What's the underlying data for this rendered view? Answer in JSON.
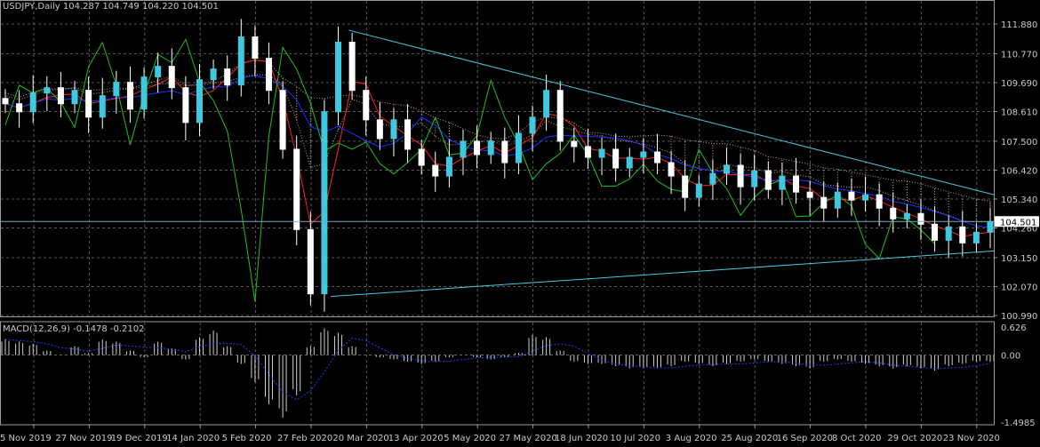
{
  "chart_data": {
    "type": "candlestick",
    "symbol_info": "USDJPY,Daily  104.287 104.749 104.220 104.501",
    "current_price": "104.501",
    "x": [
      "5 Nov 2019",
      "27 Nov 2019",
      "19 Dec 2019",
      "14 Jan 2020",
      "5 Feb 2020",
      "27 Feb 2020",
      "20 Mar 2020",
      "13 Apr 2020",
      "5 May 2020",
      "27 May 2020",
      "18 Jun 2020",
      "10 Jul 2020",
      "3 Aug 2020",
      "25 Aug 2020",
      "16 Sep 2020",
      "8 Oct 2020",
      "29 Oct 2020",
      "23 Nov 2020"
    ],
    "y_ticks": [
      "111.880",
      "110.770",
      "109.690",
      "108.610",
      "107.500",
      "106.420",
      "105.340",
      "104.260",
      "103.150",
      "102.070",
      "100.990"
    ],
    "ylim": [
      100.99,
      111.88
    ],
    "close_approx": [
      108.9,
      108.6,
      109.3,
      109.5,
      108.9,
      109.4,
      108.4,
      109.2,
      109.7,
      108.7,
      109.9,
      110.3,
      109.5,
      108.2,
      109.8,
      110.2,
      109.6,
      111.4,
      110.6,
      109.4,
      107.2,
      104.2,
      101.8,
      108.6,
      111.2,
      109.4,
      108.3,
      107.6,
      108.3,
      107.2,
      106.6,
      106.2,
      106.9,
      107.5,
      107.0,
      107.5,
      106.7,
      107.8,
      108.4,
      109.4,
      107.5,
      107.3,
      106.9,
      107.2,
      106.5,
      106.9,
      107.1,
      106.7,
      106.2,
      105.4,
      105.9,
      106.3,
      106.6,
      105.8,
      106.4,
      105.7,
      106.2,
      105.6,
      105.4,
      105.0,
      105.6,
      105.3,
      105.5,
      105.0,
      104.6,
      104.8,
      104.4,
      103.8,
      104.3,
      103.7,
      104.1,
      104.5
    ],
    "series": [
      {
        "name": "Ichimoku Kumo",
        "color": "#c8a080"
      },
      {
        "name": "Tenkan-sen",
        "color": "#ff2020"
      },
      {
        "name": "Kijun-sen",
        "color": "#2030ff"
      },
      {
        "name": "Chikou Span",
        "color": "#22c022"
      }
    ],
    "trendlines": [
      {
        "from": [
          "20 Mar 2020",
          111.65
        ],
        "to": [
          "end",
          105.5
        ]
      },
      {
        "from": [
          "9 Mar 2020",
          101.7
        ],
        "to": [
          "end",
          103.4
        ]
      },
      {
        "horizontal": 104.501
      }
    ],
    "macd": {
      "label": "MACD(12,26,9) -0.1478 -0.2102",
      "y_ticks": [
        "0.626",
        "0.00",
        "-1.4985"
      ],
      "ylim": [
        -1.4985,
        0.626
      ],
      "hist_approx": [
        0.35,
        0.3,
        0.25,
        0.1,
        0.0,
        0.2,
        0.05,
        0.35,
        0.3,
        0.1,
        -0.05,
        0.3,
        0.15,
        -0.1,
        0.4,
        0.55,
        0.2,
        -0.2,
        -0.6,
        -1.1,
        -1.4,
        -0.9,
        0.2,
        0.6,
        0.5,
        0.2,
        0.0,
        -0.05,
        -0.1,
        -0.15,
        -0.2,
        -0.15,
        -0.05,
        0.0,
        -0.05,
        -0.1,
        -0.05,
        0.05,
        0.45,
        0.4,
        0.1,
        -0.15,
        -0.2,
        -0.2,
        -0.25,
        -0.3,
        -0.3,
        -0.3,
        -0.25,
        -0.15,
        -0.2,
        -0.25,
        -0.2,
        -0.15,
        -0.1,
        -0.15,
        -0.2,
        -0.25,
        -0.3,
        -0.15,
        -0.1,
        -0.15,
        -0.2,
        -0.25,
        -0.3,
        -0.25,
        -0.3,
        -0.35,
        -0.25,
        -0.2,
        -0.15,
        -0.15
      ]
    }
  }
}
